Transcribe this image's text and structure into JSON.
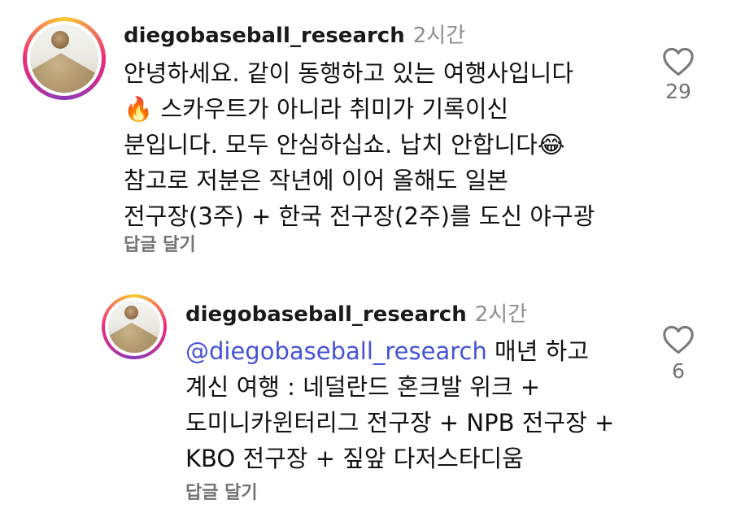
{
  "comments": [
    {
      "username": "diegobaseball_research",
      "time": "2시간",
      "text": "안녕하세요. 같이 동행하고 있는 여행사입니다\n🔥 스카우트가 아니라 취미가 기록이신\n분입니다. 모두 안심하십쇼. 납치 안합니다😂\n참고로 저분은 작년에 이어 올해도 일본\n전구장(3주) + 한국 전구장(2주)를 도신 야구광",
      "reply_label": "답글 달기",
      "likes": "29"
    },
    {
      "username": "diegobaseball_research",
      "time": "2시간",
      "mention": "@diegobaseball_research",
      "text": " 매년 하고\n계신 여행 : 네덜란드 혼크발 위크 +\n도미니카윈터리그 전구장 + NPB 전구장 +\nKBO 전구장 + 짚앞 다저스타디움",
      "reply_label": "답글 달기",
      "likes": "6"
    }
  ],
  "colors": {
    "mention": "#4553d6",
    "meta_gray": "#8e8e8e",
    "reply_gray": "#737373",
    "story_ring_start": "#f9ce34",
    "story_ring_mid": "#ee2a7b"
  },
  "icons": {
    "like": "heart-outline-icon"
  }
}
